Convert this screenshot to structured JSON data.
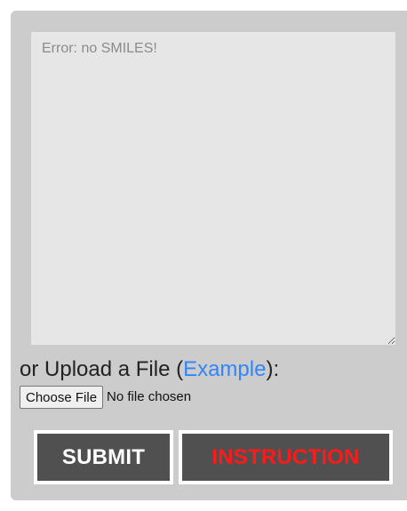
{
  "input": {
    "placeholder": "Error: no SMILES!",
    "value": ""
  },
  "upload": {
    "prefix": "or Upload a File (",
    "example_link": "Example",
    "suffix": "):",
    "choose_file_label": "Choose File",
    "file_status": "No file chosen"
  },
  "actions": {
    "submit_label": "SUBMIT",
    "instruction_label": "INSTRUCTION"
  },
  "colors": {
    "panel": "#cccccc",
    "input_background": "#e6e6e6",
    "link": "#2f86ff",
    "button_background": "#505050",
    "submit_text": "#ffffff",
    "instruction_text": "#ff1a1a"
  }
}
